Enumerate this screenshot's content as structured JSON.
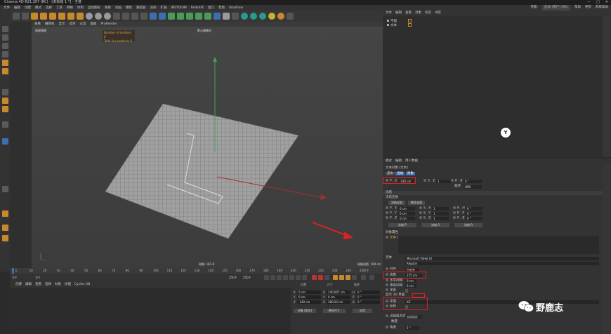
{
  "title": "Cinema 4D R21.207 (RC) - [未标题 1 *] - 主要",
  "window_controls": [
    "—",
    "□",
    "✕"
  ],
  "menu": {
    "items": [
      "文件",
      "编辑",
      "创建",
      "模式",
      "选择",
      "工具",
      "网格",
      "体积",
      "运动图形",
      "角色",
      "动画",
      "模拟",
      "跟踪器",
      "渲染",
      "扩展",
      "INSYDIUM",
      "Redshift",
      "窗口",
      "帮助",
      "RealFlow"
    ],
    "layout_label": "界面:",
    "layout_value": "启动 (用户) (RC)",
    "extra": [
      "帮助",
      "更新",
      "获取帮助"
    ]
  },
  "viewport": {
    "menu": [
      "查看",
      "摄像机",
      "显示",
      "选项",
      "过滤",
      "面板",
      "ProRender"
    ],
    "camera_label": "默认摄像机",
    "view_label": "透视视图",
    "info_lines": [
      "Number of emitters 0",
      "Total live particles 0"
    ],
    "status": "网格: 181.8",
    "grid_spacing": "网格间距: 100 cm"
  },
  "timeline": {
    "ticks": [
      "0",
      "10",
      "20",
      "30",
      "40",
      "50",
      "60",
      "70",
      "80",
      "90",
      "100",
      "110",
      "120",
      "130",
      "140",
      "150",
      "160",
      "170",
      "180",
      "190",
      "200",
      "210",
      "220",
      "230",
      "240",
      "250"
    ],
    "end_marker": "0 F",
    "start_field": "0 F",
    "current_field": "0 F",
    "end_field": "250 F",
    "end_field2": "250 F"
  },
  "materials": {
    "menu": [
      "创建",
      "编辑",
      "查看",
      "选择",
      "材质",
      "纹理",
      "Cycles 4D"
    ]
  },
  "coordinates": {
    "headers": [
      "位置",
      "尺寸",
      "旋转"
    ],
    "rows": [
      {
        "axis": "X",
        "pos": "0 cm",
        "size": "140.007 cm",
        "rot_axis": "H",
        "rot": "0 °"
      },
      {
        "axis": "Y",
        "pos": "0 cm",
        "size": "0 cm",
        "rot_axis": "P",
        "rot": "0 °"
      },
      {
        "axis": "Z",
        "pos": "-140 cm",
        "size": "280.02 cm",
        "rot_axis": "B",
        "rot": "0 °"
      }
    ],
    "mode_object": "对象 (相对)",
    "mode_size": "绝对尺寸",
    "apply": "应用"
  },
  "object_manager": {
    "menu": [
      "文件",
      "编辑",
      "查看",
      "对象",
      "标签",
      "书签"
    ],
    "objects": [
      "平面",
      "文本"
    ]
  },
  "attribute_manager": {
    "menu": [
      "模式",
      "编辑",
      "用户数据"
    ],
    "object_title": "文本对象 [文本]",
    "tabs": [
      "基本",
      "坐标",
      "对象"
    ],
    "coord_fields": [
      {
        "label": "P . Z",
        "value": "-140 cm"
      },
      {
        "label": "S . Z",
        "value": "1"
      },
      {
        "label": "R . B",
        "value": "0 °"
      }
    ],
    "order_label": "顺序",
    "order_value": "HPB",
    "sec_freeze": "冻结",
    "sec_freeze_transform": "冻结变换",
    "freeze_buttons": [
      "冻结全部",
      "解冻全部"
    ],
    "freeze_rows": [
      {
        "p": "0 cm",
        "s": "1",
        "r": "0 °",
        "pa": "P . X",
        "sa": "S . X",
        "ra": "R . H"
      },
      {
        "p": "0 cm",
        "s": "1",
        "r": "0 °",
        "pa": "P . Y",
        "sa": "S . Y",
        "ra": "R . P"
      },
      {
        "p": "0 cm",
        "s": "1",
        "r": "0 °",
        "pa": "P . Z",
        "sa": "S . Z",
        "ra": "R . B"
      }
    ],
    "freeze_p_buttons": [
      "冻结 P",
      "冻结 S",
      "冻结 R"
    ],
    "obj_props": "对象属性",
    "text_label": "文本",
    "text_value": "L",
    "font_label": "字体",
    "font_value": "Microsoft YaHei UI",
    "font_style": "Regular",
    "align_label": "对齐",
    "align_value": "中对齐",
    "height_label": "高度",
    "height_value": "275 cm",
    "hspacing_label": "水平间隔",
    "hspacing_value": "0 cm",
    "vspacing_label": "垂直间隔",
    "vspacing_value": "0 cm",
    "kerning_label": "字距",
    "kerning_value": "",
    "show3d_label": "显示 3D 界面",
    "plane_label": "平面",
    "plane_value": "XZ",
    "reverse_label": "反转",
    "points_label": "点插值方式",
    "points_value": "自动适应",
    "count_label": "数量",
    "angle_label": "角度",
    "angle_value": "5 °"
  },
  "watermark": {
    "text": "野鹿志"
  }
}
